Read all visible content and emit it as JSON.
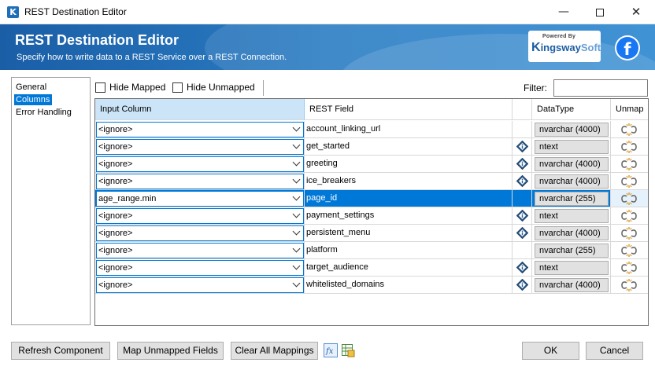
{
  "window": {
    "title": "REST Destination Editor",
    "app_icon_letter": "K"
  },
  "banner": {
    "title": "REST Destination Editor",
    "subtitle": "Specify how to write data to a REST Service over a REST Connection.",
    "logo_powered": "Powered By",
    "logo_k": "K",
    "logo_ingsway": "ingsway",
    "logo_soft": "Soft",
    "facebook_letter": "f"
  },
  "nav": {
    "items": [
      {
        "label": "General",
        "selected": false
      },
      {
        "label": "Columns",
        "selected": true
      },
      {
        "label": "Error Handling",
        "selected": false
      }
    ]
  },
  "toolbar": {
    "hide_mapped_label": "Hide Mapped",
    "hide_mapped_checked": false,
    "hide_unmapped_label": "Hide Unmapped",
    "hide_unmapped_checked": false,
    "filter_label": "Filter:",
    "filter_value": ""
  },
  "grid": {
    "headers": {
      "input_column": "Input Column",
      "rest_field": "REST Field",
      "info": "",
      "data_type": "DataType",
      "unmap": "Unmap"
    },
    "rows": [
      {
        "input": "<ignore>",
        "field": "account_linking_url",
        "info": false,
        "type": "nvarchar (4000)",
        "selected": false
      },
      {
        "input": "<ignore>",
        "field": "get_started",
        "info": true,
        "type": "ntext",
        "selected": false
      },
      {
        "input": "<ignore>",
        "field": "greeting",
        "info": true,
        "type": "nvarchar (4000)",
        "selected": false
      },
      {
        "input": "<ignore>",
        "field": "ice_breakers",
        "info": true,
        "type": "nvarchar (4000)",
        "selected": false
      },
      {
        "input": "age_range.min",
        "field": "page_id",
        "info": false,
        "type": "nvarchar (255)",
        "selected": true
      },
      {
        "input": "<ignore>",
        "field": "payment_settings",
        "info": true,
        "type": "ntext",
        "selected": false
      },
      {
        "input": "<ignore>",
        "field": "persistent_menu",
        "info": true,
        "type": "nvarchar (4000)",
        "selected": false
      },
      {
        "input": "<ignore>",
        "field": "platform",
        "info": false,
        "type": "nvarchar (255)",
        "selected": false
      },
      {
        "input": "<ignore>",
        "field": "target_audience",
        "info": true,
        "type": "ntext",
        "selected": false
      },
      {
        "input": "<ignore>",
        "field": "whitelisted_domains",
        "info": true,
        "type": "nvarchar (4000)",
        "selected": false
      }
    ]
  },
  "buttons": {
    "refresh": "Refresh Component",
    "map_unmapped": "Map Unmapped Fields",
    "clear_all": "Clear All Mappings",
    "ok": "OK",
    "cancel": "Cancel"
  },
  "colors": {
    "accent": "#0078d7",
    "banner": "#2b7dc4",
    "header_selected": "#cce4f7"
  },
  "icons": {
    "app": "kingswaysoft-k-icon",
    "info": "info-diamond-icon",
    "unmap": "unmap-icon",
    "expression": "fx-icon",
    "grid_settings": "grid-settings-icon"
  }
}
